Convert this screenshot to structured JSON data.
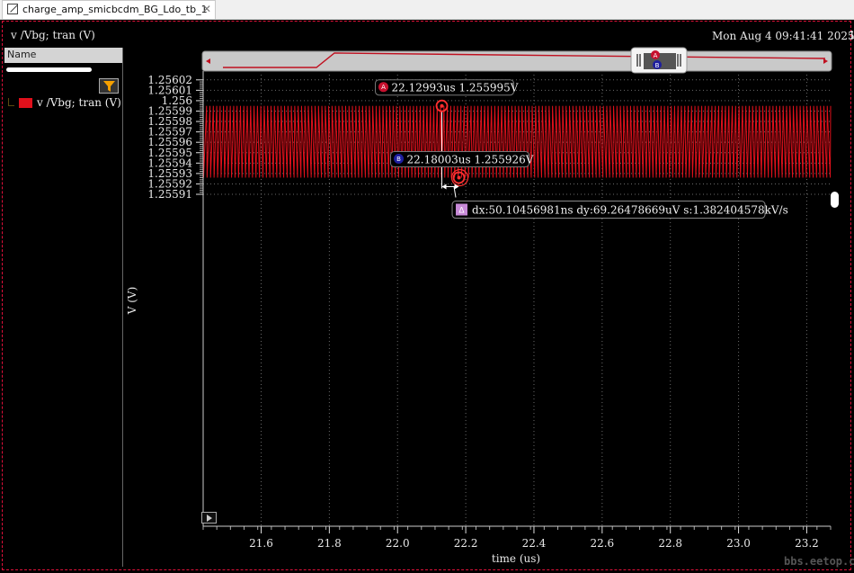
{
  "tab": {
    "title": "charge_amp_smicbcdm_BG_Ldo_tb_1",
    "close": "✕"
  },
  "header": {
    "plot_title": "v /Vbg; tran (V)",
    "datestamp": "Mon Aug 4 09:41:41 2025",
    "stub": "1"
  },
  "panel": {
    "name_header": "Name"
  },
  "legend": [
    {
      "label": "v /Vbg; tran (V)",
      "color": "#e0101b"
    }
  ],
  "colors": {
    "trace": "#e0101b",
    "background": "#000000",
    "grid": "#6a6a6a",
    "frame": "#e0103a",
    "marker_a": "#c8102e",
    "marker_b": "#1e1e9e",
    "delta_badge": "#c88ad8"
  },
  "icons": [
    "file-icon",
    "close-icon",
    "filter-icon",
    "play-icon",
    "marker-a-icon",
    "marker-b-icon",
    "delta-icon"
  ],
  "chart_data": {
    "type": "line",
    "xlabel": "time (us)",
    "ylabel": "V (V)",
    "xlim": [
      21.43,
      23.27
    ],
    "ylim": [
      1.255591,
      1.256025
    ],
    "x_ticks": [
      "21.6",
      "21.8",
      "22.0",
      "22.2",
      "22.4",
      "22.6",
      "22.8",
      "23.0",
      "23.2"
    ],
    "y_ticks": [
      "1.25591",
      "1.25592",
      "1.25593",
      "1.25594",
      "1.25595",
      "1.25596",
      "1.25597",
      "1.25598",
      "1.25599",
      "1.256",
      "1.25601",
      "1.25602"
    ],
    "grid": true,
    "series": [
      {
        "name": "v /Vbg; tran (V)",
        "x_start": 21.43,
        "x_end": 23.27,
        "v_max": 1.255995,
        "v_min": 1.255926,
        "cycles": 185,
        "envelope_period": 0.74
      }
    ],
    "markers": [
      {
        "id": "A",
        "x": 22.12993,
        "y": 1.255995,
        "label": "22.12993us 1.255995V"
      },
      {
        "id": "B",
        "x": 22.18003,
        "y": 1.255926,
        "label": "22.18003us 1.255926V"
      }
    ],
    "delta": {
      "label": "dx:50.10456981ns dy:69.26478669uV s:1.382404578kV/s"
    }
  },
  "overview": {
    "markers": [
      "A",
      "B"
    ]
  }
}
